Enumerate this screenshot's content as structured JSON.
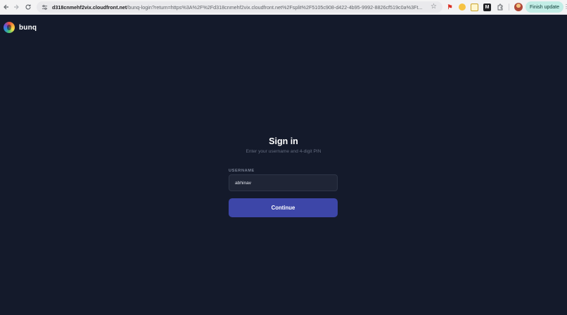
{
  "browser": {
    "url_host": "d318cnmehf2vix.cloudfront.net",
    "url_path": "/bunq-login?return=https%3A%2F%2Fd318cnmehf2vix.cloudfront.net%2Fsplit%2F5105c908-d422-4b95-9992-8826cf519c0a%3Ft...",
    "finish_update_label": "Finish update",
    "extension_m_label": "M"
  },
  "app": {
    "brand_name": "bunq"
  },
  "login": {
    "title": "Sign in",
    "subtitle": "Enter your username and 4-digit PIN",
    "username_label": "USERNAME",
    "username_value": "abhinav",
    "continue_label": "Continue"
  }
}
